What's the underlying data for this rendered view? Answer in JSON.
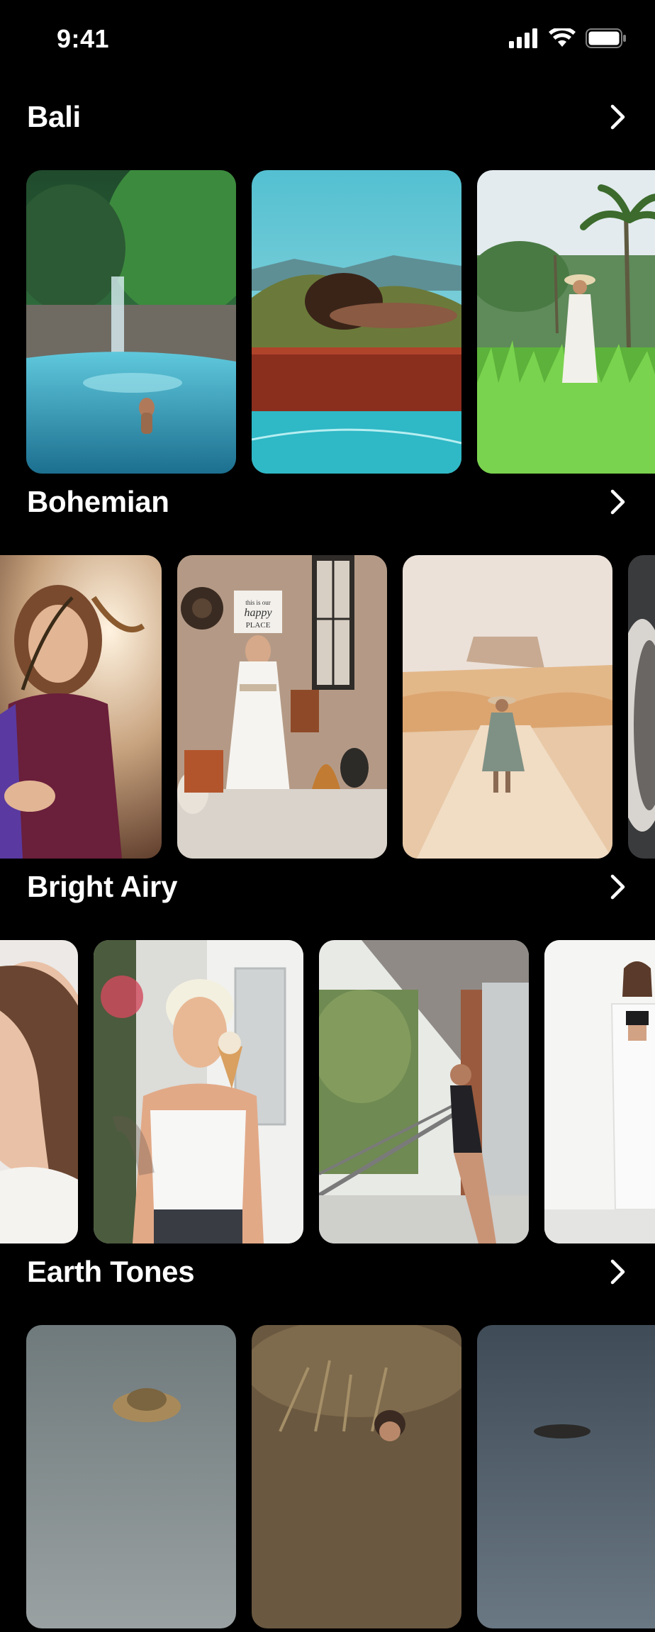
{
  "status_bar": {
    "time": "9:41",
    "icons": [
      "signal-icon",
      "wifi-icon",
      "battery-icon"
    ]
  },
  "sections": [
    {
      "title": "Bali",
      "cards": [
        {
          "subject": "waterfall-pool"
        },
        {
          "subject": "poolside-lounge"
        },
        {
          "subject": "rice-terrace-palms"
        }
      ]
    },
    {
      "title": "Bohemian",
      "cards": [
        {
          "subject": "feather-portrait"
        },
        {
          "subject": "boho-interior-sign",
          "sign_text": "this is our happy PLACE"
        },
        {
          "subject": "desert-road"
        },
        {
          "subject": "wicker-chair"
        }
      ]
    },
    {
      "title": "Bright Airy",
      "cards": [
        {
          "subject": "hair-portrait"
        },
        {
          "subject": "ice-cream"
        },
        {
          "subject": "balcony-pose"
        },
        {
          "subject": "white-studio"
        }
      ]
    },
    {
      "title": "Earth Tones",
      "cards": [
        {
          "subject": "straw-hat-portrait"
        },
        {
          "subject": "dry-grass"
        },
        {
          "subject": "dusk-sky"
        }
      ]
    }
  ],
  "colors": {
    "background": "#000000",
    "text": "#ffffff"
  }
}
